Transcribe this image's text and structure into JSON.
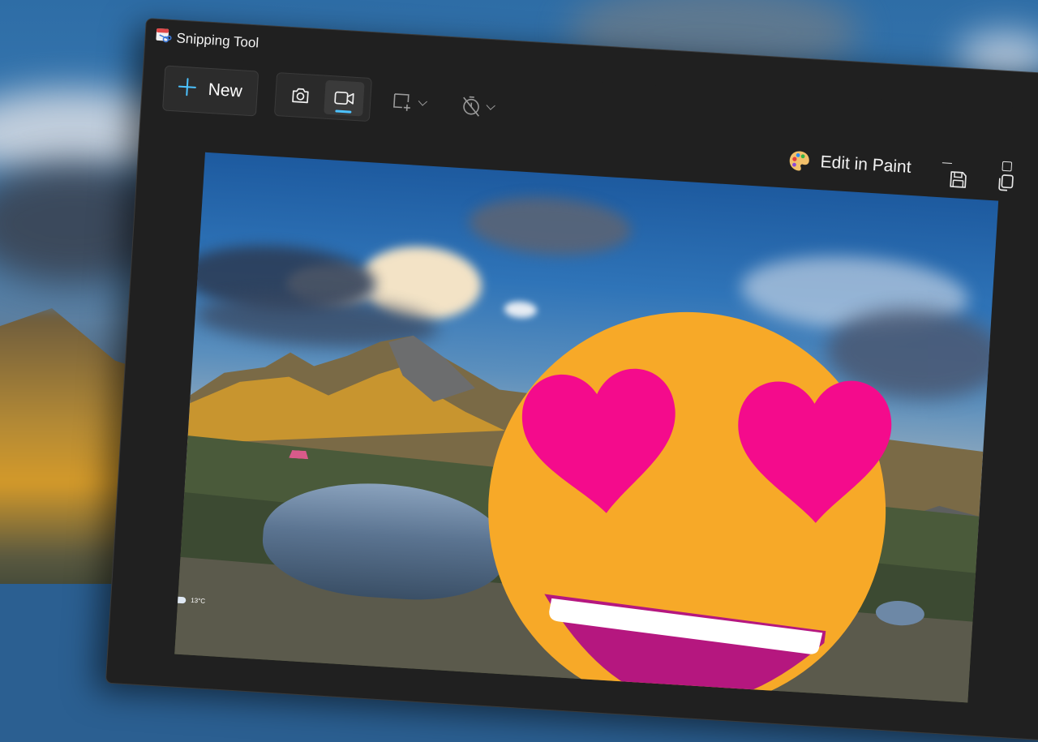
{
  "window": {
    "title": "Snipping Tool"
  },
  "toolbar": {
    "new_label": "New",
    "mode_selected": "video",
    "accent_color": "#4cc2ff"
  },
  "actions": {
    "edit_in_paint_label": "Edit in Paint"
  },
  "canvas": {
    "weather_temp": "13°C"
  },
  "colors": {
    "window_bg": "#202020",
    "emoji_face": "#f7a928",
    "emoji_hearts": "#f40b8c",
    "emoji_mouth": "#b5177f"
  }
}
